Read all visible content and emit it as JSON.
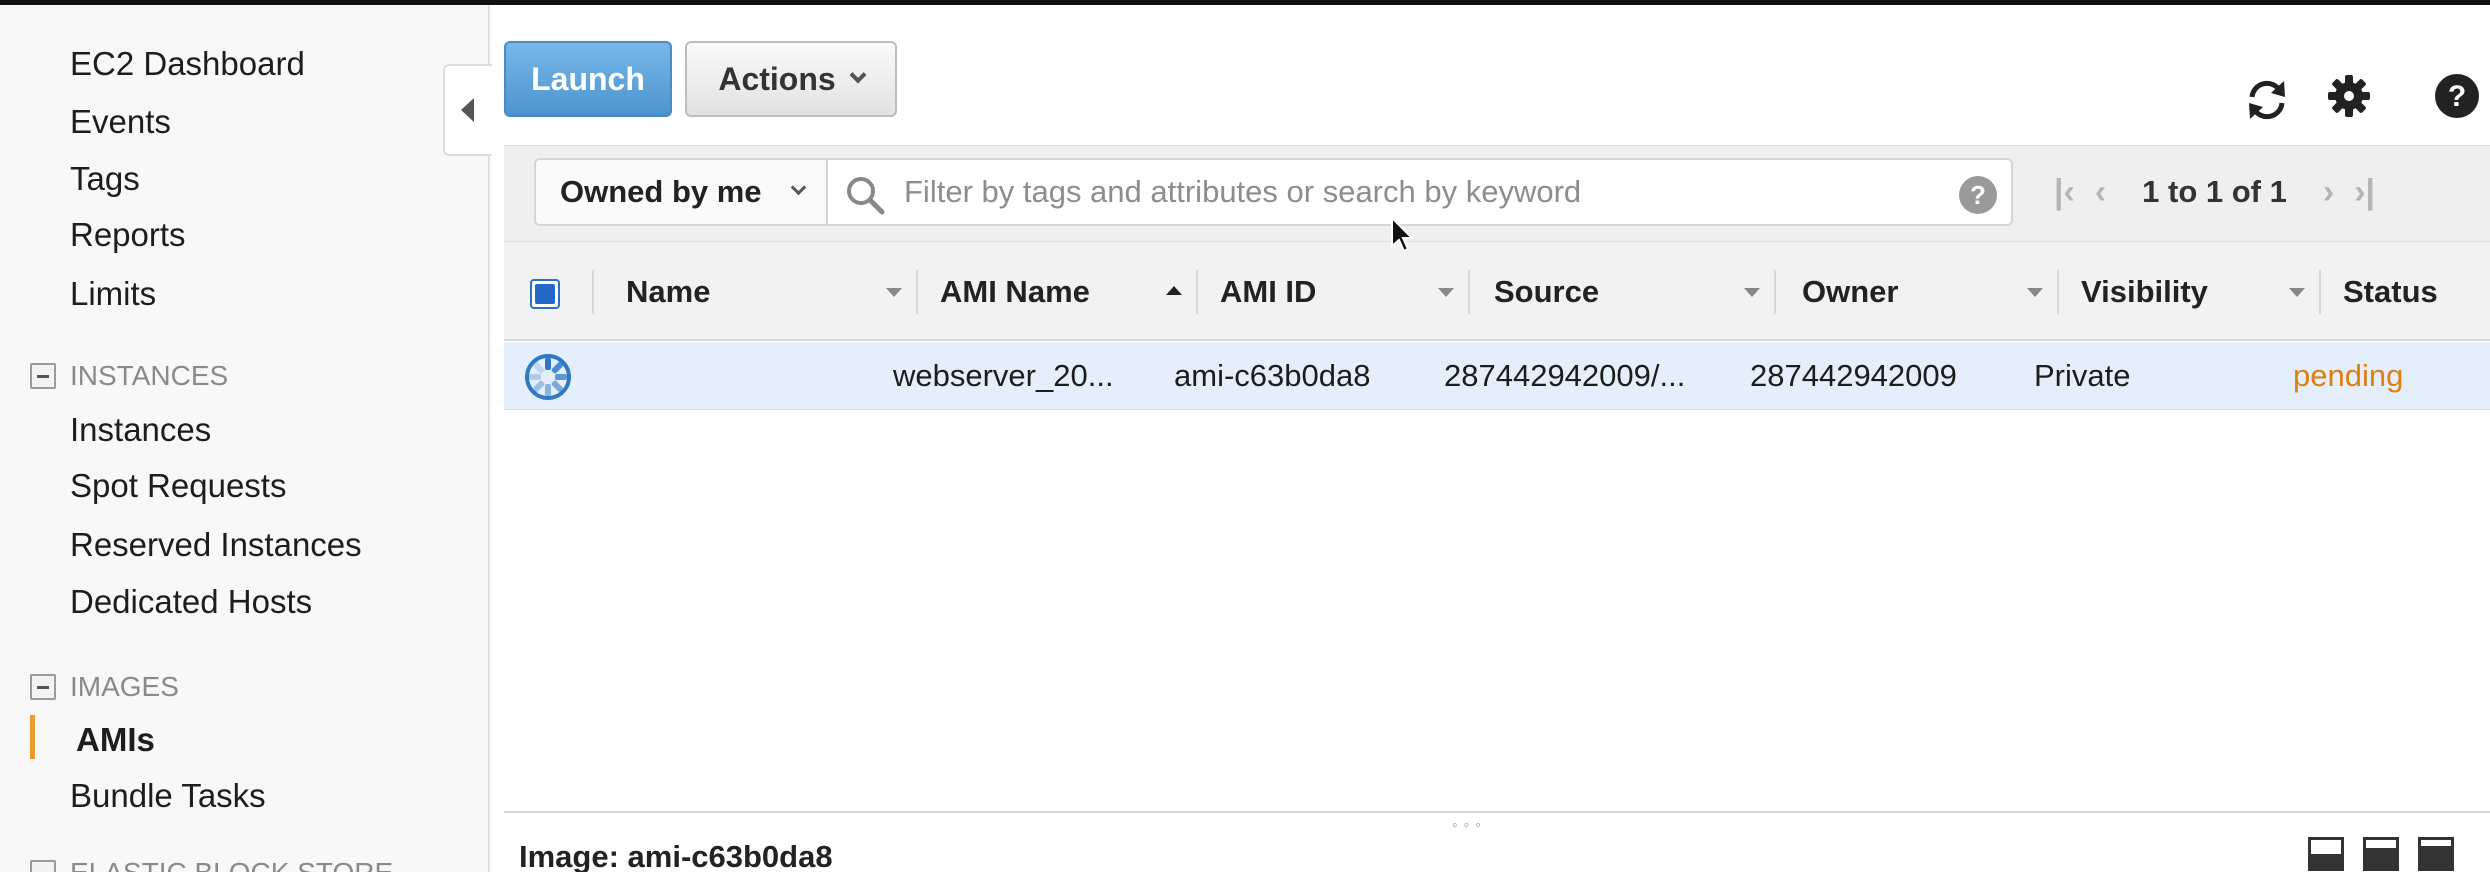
{
  "sidebar": {
    "items": [
      {
        "label": "EC2 Dashboard"
      },
      {
        "label": "Events"
      },
      {
        "label": "Tags"
      },
      {
        "label": "Reports"
      },
      {
        "label": "Limits"
      }
    ],
    "sections": [
      {
        "title": "INSTANCES",
        "items": [
          "Instances",
          "Spot Requests",
          "Reserved Instances",
          "Dedicated Hosts"
        ]
      },
      {
        "title": "IMAGES",
        "items": [
          "AMIs",
          "Bundle Tasks"
        ]
      },
      {
        "title": "ELASTIC BLOCK STORE"
      }
    ],
    "active_item": "AMIs",
    "accent_color": "#e99b2c"
  },
  "toolbar": {
    "launch_label": "Launch",
    "actions_label": "Actions",
    "icons": [
      "refresh-icon",
      "gear-icon",
      "help-icon"
    ]
  },
  "filter": {
    "owner_selected": "Owned by me",
    "search_placeholder": "Filter by tags and attributes or search by keyword",
    "pagination_text": "1 to 1 of 1"
  },
  "table": {
    "columns": [
      "Name",
      "AMI Name",
      "AMI ID",
      "Source",
      "Owner",
      "Visibility",
      "Status"
    ],
    "rows": [
      {
        "name": "",
        "ami_name": "webserver_20...",
        "ami_id": "ami-c63b0da8",
        "source": "287442942009/...",
        "owner": "287442942009",
        "visibility": "Private",
        "status": "pending"
      }
    ],
    "status_color": "#de7f10",
    "selected_row_color": "#e5effb"
  },
  "detail": {
    "title": "Image: ami-c63b0da8"
  }
}
